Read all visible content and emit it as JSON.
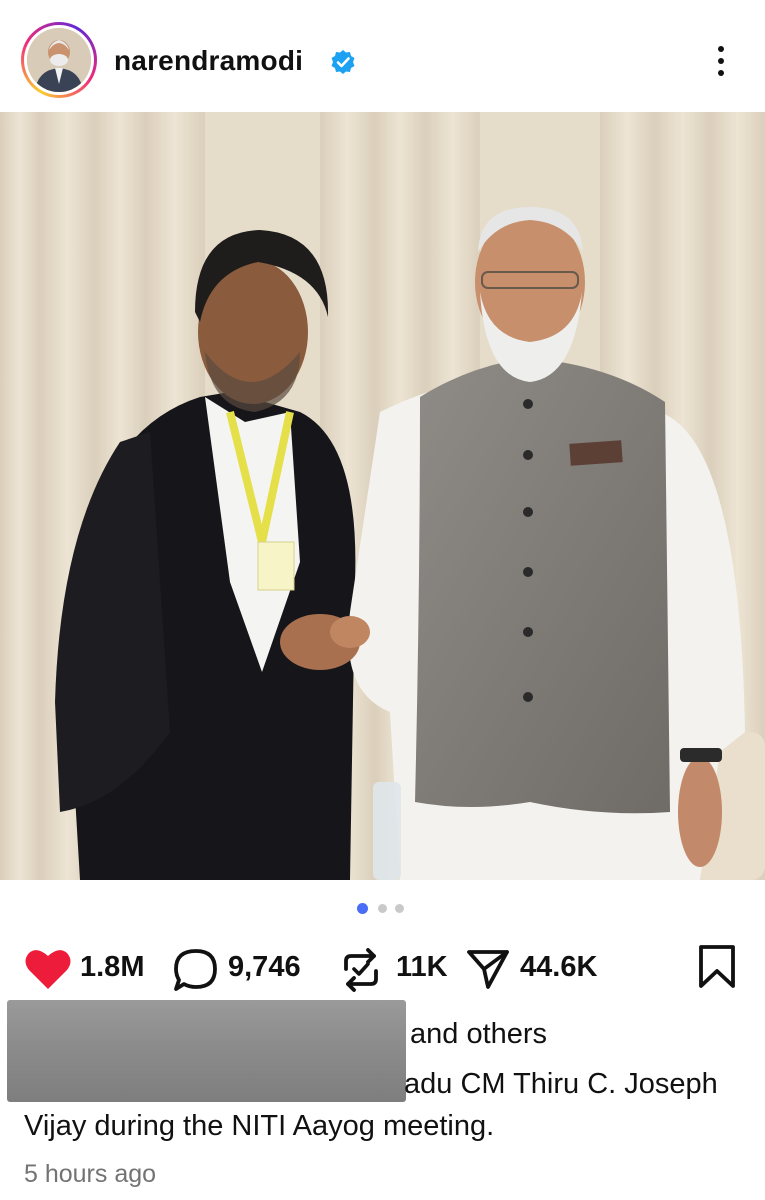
{
  "post": {
    "username": "narendramodi",
    "verified": true,
    "carousel": {
      "current": 1,
      "total": 3
    },
    "likes_count": "1.8M",
    "comments_count": "9,746",
    "reposts_count": "11K",
    "shares_count": "44.6K",
    "liked_by_suffix": "and others",
    "caption_line_1": "adu CM Thiru C. Joseph",
    "caption_line_2": "Vijay during the NITI Aayog meeting.",
    "timestamp": "5 hours ago"
  },
  "colors": {
    "like_active": "#ed1c3a",
    "text_primary": "#111111",
    "text_secondary": "#737373",
    "verified_badge": "#1da1f2",
    "dot_active": "#4a6cf7",
    "dot_inactive": "#c9c9c9",
    "redaction": "#8b8b8b"
  },
  "icons": {
    "more": "more-vertical-icon",
    "like": "heart-icon",
    "comment": "comment-bubble-icon",
    "repost": "repost-icon",
    "share": "paper-plane-icon",
    "save": "bookmark-icon",
    "verified": "verified-badge-icon"
  }
}
